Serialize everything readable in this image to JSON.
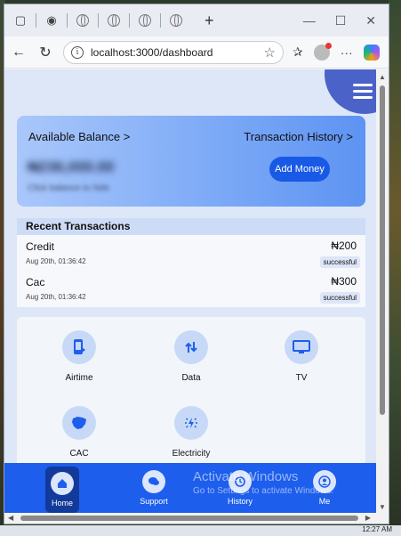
{
  "browser": {
    "tabs": [
      "",
      "",
      "",
      "",
      ""
    ],
    "url": "localhost:3000/dashboard"
  },
  "card": {
    "balance_label": "Available Balance >",
    "history_label": "Transaction History >",
    "balance_amount": "₦236,000.00",
    "balance_sub": "Click balance to hide",
    "add_money": "Add Money"
  },
  "recent": {
    "title": "Recent Transactions",
    "items": [
      {
        "name": "Credit",
        "date": "Aug 20th, 01:36:42",
        "amount": "₦200",
        "status": "successful"
      },
      {
        "name": "Cac",
        "date": "Aug 20th, 01:36:42",
        "amount": "₦300",
        "status": "successful"
      }
    ]
  },
  "services": [
    {
      "label": "Airtime",
      "icon": "phone-icon"
    },
    {
      "label": "Data",
      "icon": "data-arrows-icon"
    },
    {
      "label": "TV",
      "icon": "tv-icon"
    },
    {
      "label": "CAC",
      "icon": "nigeria-map-icon"
    },
    {
      "label": "Electricity",
      "icon": "electricity-icon"
    }
  ],
  "nav": [
    {
      "label": "Home",
      "icon": "home-icon"
    },
    {
      "label": "Support",
      "icon": "chat-icon"
    },
    {
      "label": "History",
      "icon": "history-icon"
    },
    {
      "label": "Me",
      "icon": "user-icon"
    }
  ],
  "watermark": {
    "title": "Activate Windows",
    "sub": "Go to Settings to activate Windows."
  },
  "taskbar": {
    "clock": "12:27 AM"
  },
  "colors": {
    "accent": "#1d5eec",
    "card": "#7aa8f6",
    "icon_bg": "#c7d9f7"
  }
}
